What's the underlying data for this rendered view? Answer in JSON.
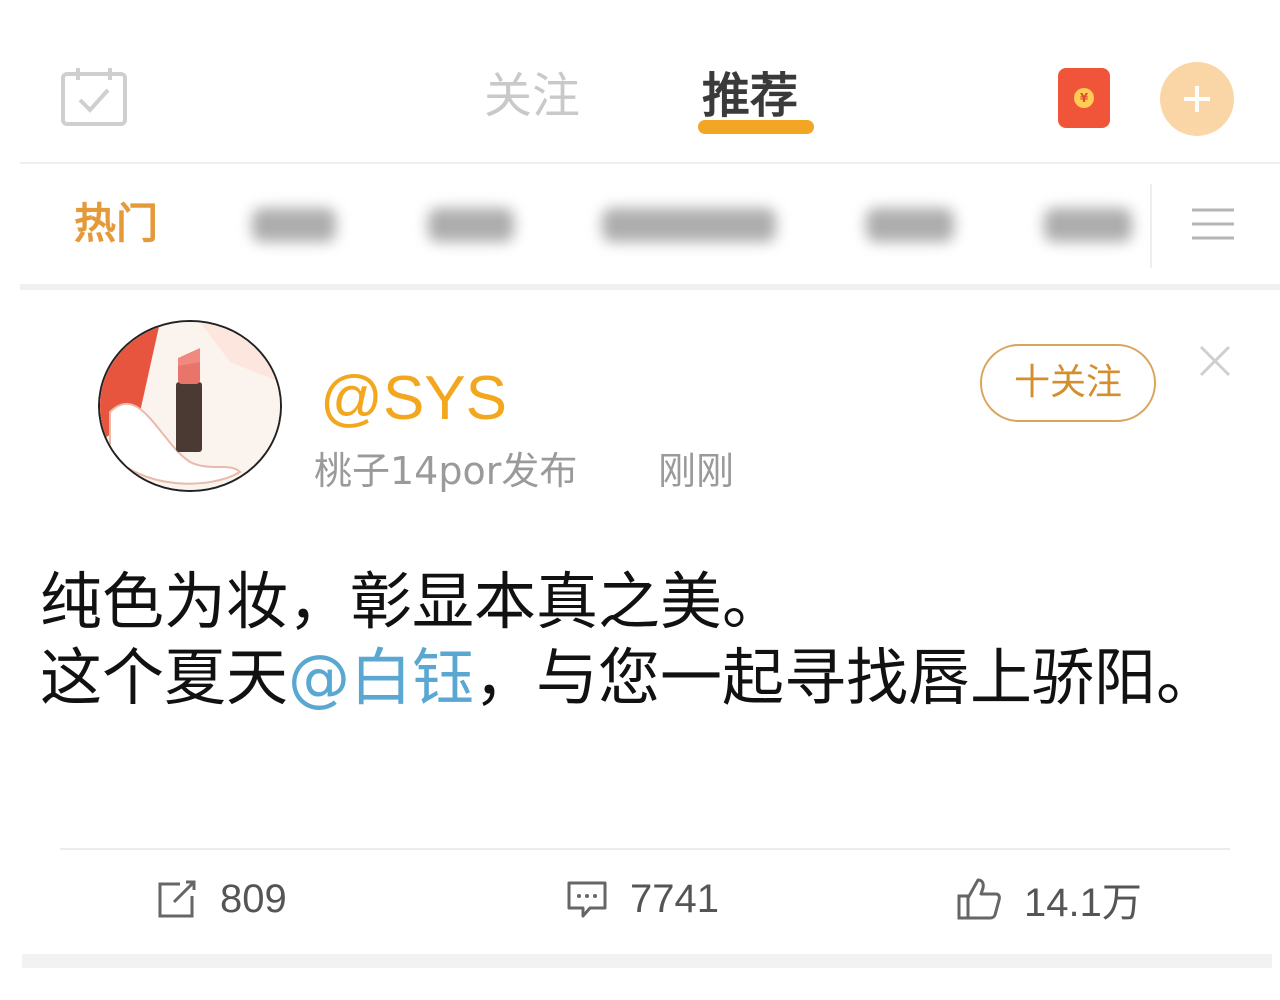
{
  "header": {
    "tabs": [
      {
        "label": "关注",
        "active": false
      },
      {
        "label": "推荐",
        "active": true
      }
    ],
    "icons": {
      "left": "calendar-check-icon",
      "red_packet": "red-packet-icon",
      "red_packet_symbol": "¥",
      "add": "plus-icon"
    },
    "accent_color": "#f3a623"
  },
  "category_bar": {
    "active_label": "热门",
    "blurred_tab_count": 6,
    "menu_icon": "hamburger-menu-icon"
  },
  "post": {
    "username": "@SYS",
    "source": "桃子14por发布",
    "time": "刚刚",
    "follow_label": "十关注",
    "close_icon": "close-icon",
    "text_line1": "纯色为妆，彰显本真之美。",
    "text_line2_pre": "这个夏天",
    "mention": "@白钰",
    "text_line2_post": "，与您一起寻找唇上骄阳。",
    "mention_color": "#5aa7d2",
    "username_color": "#f2a71e",
    "actions": {
      "repost": {
        "icon": "share-icon",
        "count": "809"
      },
      "comment": {
        "icon": "comment-icon",
        "count": "7741"
      },
      "like": {
        "icon": "thumbs-up-icon",
        "count": "14.1万"
      }
    }
  }
}
